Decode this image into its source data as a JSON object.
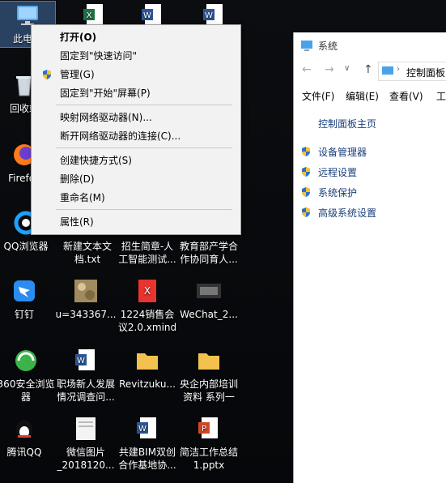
{
  "desktop": {
    "icons": [
      {
        "label": "此电脑"
      },
      {
        "label": "回收站"
      },
      {
        "label": "Firefox"
      },
      {
        "label": "QQ浏览器"
      },
      {
        "label": "新建文本文档.txt"
      },
      {
        "label": "招生简章-人工智能测试..."
      },
      {
        "label": "教育部产学合作协同育人..."
      },
      {
        "label": "钉钉"
      },
      {
        "label": "u=343367..."
      },
      {
        "label": "1224销售会议2.0.xmind"
      },
      {
        "label": "WeChat_2..."
      },
      {
        "label": "360安全浏览器"
      },
      {
        "label": "职场新人发展情况调查问..."
      },
      {
        "label": "Revitzuku..."
      },
      {
        "label": "央企内部培训资料 系列一"
      },
      {
        "label": "腾讯QQ"
      },
      {
        "label": "微信图片_2018120..."
      },
      {
        "label": "共建BIM双创合作基地协..."
      },
      {
        "label": "简洁工作总结1.pptx"
      }
    ]
  },
  "context_menu": {
    "items": [
      {
        "label": "打开(O)"
      },
      {
        "label": "固定到\"快速访问\""
      },
      {
        "label": "管理(G)"
      },
      {
        "label": "固定到\"开始\"屏幕(P)"
      },
      {
        "label": "映射网络驱动器(N)..."
      },
      {
        "label": "断开网络驱动器的连接(C)..."
      },
      {
        "label": "创建快捷方式(S)"
      },
      {
        "label": "删除(D)"
      },
      {
        "label": "重命名(M)"
      },
      {
        "label": "属性(R)"
      }
    ]
  },
  "system_window": {
    "title": "系统",
    "address": "控制面板",
    "menu": [
      "文件(F)",
      "编辑(E)",
      "查看(V)",
      "工"
    ],
    "home_link": "控制面板主页",
    "links": [
      "设备管理器",
      "远程设置",
      "系统保护",
      "高级系统设置"
    ]
  },
  "colors": {
    "shield_blue": "#2f6fd0",
    "shield_yellow": "#f1c232",
    "link": "#1a3f7a"
  }
}
